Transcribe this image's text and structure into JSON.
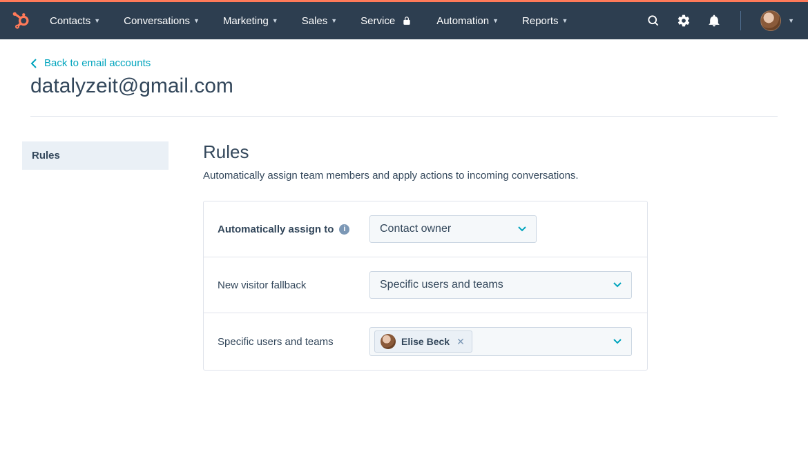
{
  "nav": {
    "items": [
      {
        "label": "Contacts",
        "caret": true
      },
      {
        "label": "Conversations",
        "caret": true
      },
      {
        "label": "Marketing",
        "caret": true
      },
      {
        "label": "Sales",
        "caret": true
      },
      {
        "label": "Service",
        "locked": true
      },
      {
        "label": "Automation",
        "caret": true
      },
      {
        "label": "Reports",
        "caret": true
      }
    ]
  },
  "back_link": "Back to email accounts",
  "page_title": "datalyzeit@gmail.com",
  "side_tab": "Rules",
  "rules": {
    "heading": "Rules",
    "subheading": "Automatically assign team members and apply actions to incoming conversations.",
    "row1": {
      "label": "Automatically assign to",
      "value": "Contact owner"
    },
    "row2": {
      "label": "New visitor fallback",
      "value": "Specific users and teams"
    },
    "row3": {
      "label": "Specific users and teams",
      "chip": "Elise Beck"
    }
  }
}
